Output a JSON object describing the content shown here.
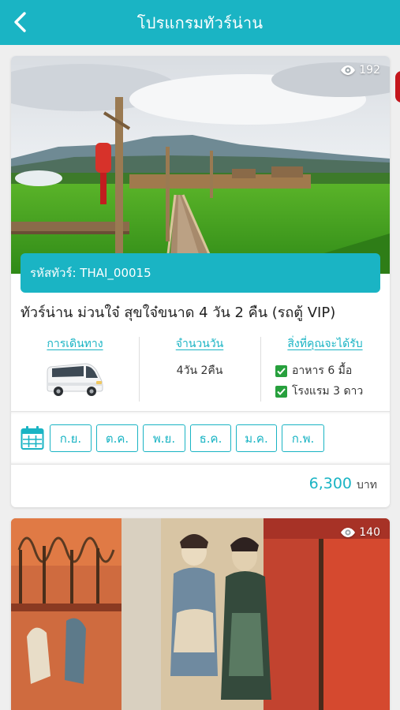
{
  "header": {
    "title": "โปรแกรมทัวร์น่าน",
    "back_icon": "chevron-left-icon"
  },
  "tours": [
    {
      "views": "192",
      "code_label": "รหัสทัวร์: THAI_00015",
      "title": "ทัวร์น่าน ม่วนใจ๋ สุขใจ๋ขนาด 4 วัน 2 คืน (รถตู้ VIP)",
      "travel_label": "การเดินทาง",
      "travel_icon": "van-icon",
      "duration_label": "จำนวนวัน",
      "duration_value": "4วัน 2คืน",
      "includes_label": "สิ่งที่คุณจะได้รับ",
      "includes": [
        "อาหาร 6 มื้อ",
        "โรงแรม 3 ดาว"
      ],
      "calendar_icon": "calendar-icon",
      "months": [
        "ก.ย.",
        "ต.ค.",
        "พ.ย.",
        "ธ.ค.",
        "ม.ค.",
        "ก.พ."
      ],
      "price": "6,300",
      "price_unit": "บาท"
    },
    {
      "views": "140"
    }
  ],
  "colors": {
    "accent": "#1ab4c4",
    "check_green": "#27a03d",
    "background": "#efefef"
  }
}
